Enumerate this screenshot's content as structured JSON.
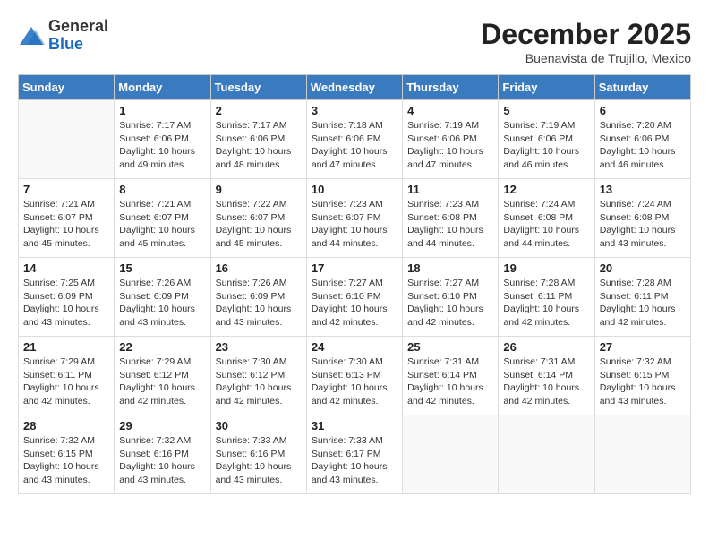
{
  "header": {
    "logo_general": "General",
    "logo_blue": "Blue",
    "month_title": "December 2025",
    "location": "Buenavista de Trujillo, Mexico"
  },
  "days_of_week": [
    "Sunday",
    "Monday",
    "Tuesday",
    "Wednesday",
    "Thursday",
    "Friday",
    "Saturday"
  ],
  "weeks": [
    [
      {
        "day": "",
        "info": ""
      },
      {
        "day": "1",
        "info": "Sunrise: 7:17 AM\nSunset: 6:06 PM\nDaylight: 10 hours\nand 49 minutes."
      },
      {
        "day": "2",
        "info": "Sunrise: 7:17 AM\nSunset: 6:06 PM\nDaylight: 10 hours\nand 48 minutes."
      },
      {
        "day": "3",
        "info": "Sunrise: 7:18 AM\nSunset: 6:06 PM\nDaylight: 10 hours\nand 47 minutes."
      },
      {
        "day": "4",
        "info": "Sunrise: 7:19 AM\nSunset: 6:06 PM\nDaylight: 10 hours\nand 47 minutes."
      },
      {
        "day": "5",
        "info": "Sunrise: 7:19 AM\nSunset: 6:06 PM\nDaylight: 10 hours\nand 46 minutes."
      },
      {
        "day": "6",
        "info": "Sunrise: 7:20 AM\nSunset: 6:06 PM\nDaylight: 10 hours\nand 46 minutes."
      }
    ],
    [
      {
        "day": "7",
        "info": "Sunrise: 7:21 AM\nSunset: 6:07 PM\nDaylight: 10 hours\nand 45 minutes."
      },
      {
        "day": "8",
        "info": "Sunrise: 7:21 AM\nSunset: 6:07 PM\nDaylight: 10 hours\nand 45 minutes."
      },
      {
        "day": "9",
        "info": "Sunrise: 7:22 AM\nSunset: 6:07 PM\nDaylight: 10 hours\nand 45 minutes."
      },
      {
        "day": "10",
        "info": "Sunrise: 7:23 AM\nSunset: 6:07 PM\nDaylight: 10 hours\nand 44 minutes."
      },
      {
        "day": "11",
        "info": "Sunrise: 7:23 AM\nSunset: 6:08 PM\nDaylight: 10 hours\nand 44 minutes."
      },
      {
        "day": "12",
        "info": "Sunrise: 7:24 AM\nSunset: 6:08 PM\nDaylight: 10 hours\nand 44 minutes."
      },
      {
        "day": "13",
        "info": "Sunrise: 7:24 AM\nSunset: 6:08 PM\nDaylight: 10 hours\nand 43 minutes."
      }
    ],
    [
      {
        "day": "14",
        "info": "Sunrise: 7:25 AM\nSunset: 6:09 PM\nDaylight: 10 hours\nand 43 minutes."
      },
      {
        "day": "15",
        "info": "Sunrise: 7:26 AM\nSunset: 6:09 PM\nDaylight: 10 hours\nand 43 minutes."
      },
      {
        "day": "16",
        "info": "Sunrise: 7:26 AM\nSunset: 6:09 PM\nDaylight: 10 hours\nand 43 minutes."
      },
      {
        "day": "17",
        "info": "Sunrise: 7:27 AM\nSunset: 6:10 PM\nDaylight: 10 hours\nand 42 minutes."
      },
      {
        "day": "18",
        "info": "Sunrise: 7:27 AM\nSunset: 6:10 PM\nDaylight: 10 hours\nand 42 minutes."
      },
      {
        "day": "19",
        "info": "Sunrise: 7:28 AM\nSunset: 6:11 PM\nDaylight: 10 hours\nand 42 minutes."
      },
      {
        "day": "20",
        "info": "Sunrise: 7:28 AM\nSunset: 6:11 PM\nDaylight: 10 hours\nand 42 minutes."
      }
    ],
    [
      {
        "day": "21",
        "info": "Sunrise: 7:29 AM\nSunset: 6:11 PM\nDaylight: 10 hours\nand 42 minutes."
      },
      {
        "day": "22",
        "info": "Sunrise: 7:29 AM\nSunset: 6:12 PM\nDaylight: 10 hours\nand 42 minutes."
      },
      {
        "day": "23",
        "info": "Sunrise: 7:30 AM\nSunset: 6:12 PM\nDaylight: 10 hours\nand 42 minutes."
      },
      {
        "day": "24",
        "info": "Sunrise: 7:30 AM\nSunset: 6:13 PM\nDaylight: 10 hours\nand 42 minutes."
      },
      {
        "day": "25",
        "info": "Sunrise: 7:31 AM\nSunset: 6:14 PM\nDaylight: 10 hours\nand 42 minutes."
      },
      {
        "day": "26",
        "info": "Sunrise: 7:31 AM\nSunset: 6:14 PM\nDaylight: 10 hours\nand 42 minutes."
      },
      {
        "day": "27",
        "info": "Sunrise: 7:32 AM\nSunset: 6:15 PM\nDaylight: 10 hours\nand 43 minutes."
      }
    ],
    [
      {
        "day": "28",
        "info": "Sunrise: 7:32 AM\nSunset: 6:15 PM\nDaylight: 10 hours\nand 43 minutes."
      },
      {
        "day": "29",
        "info": "Sunrise: 7:32 AM\nSunset: 6:16 PM\nDaylight: 10 hours\nand 43 minutes."
      },
      {
        "day": "30",
        "info": "Sunrise: 7:33 AM\nSunset: 6:16 PM\nDaylight: 10 hours\nand 43 minutes."
      },
      {
        "day": "31",
        "info": "Sunrise: 7:33 AM\nSunset: 6:17 PM\nDaylight: 10 hours\nand 43 minutes."
      },
      {
        "day": "",
        "info": ""
      },
      {
        "day": "",
        "info": ""
      },
      {
        "day": "",
        "info": ""
      }
    ]
  ]
}
